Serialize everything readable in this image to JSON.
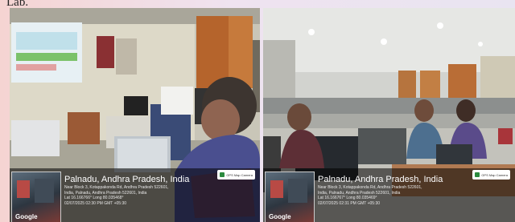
{
  "header_fragment": "Lab.",
  "photos": [
    {
      "alt": "Computer lab with projector screen and a man working on a laptop",
      "thumbnail_label": "Google",
      "badge_text": "GPS Map Camera",
      "location_title": "Palnadu, Andhra Pradesh, India",
      "address_line1": "Near Block 3, Kotappakonda Rd, Andhra Pradesh 522601,",
      "address_line2": "India, Palnadu, Andhra Pradesh 522601, India",
      "coords": "Lat 16.166766° Long 80.035468°",
      "datetime": "02/07/2025 02:30 PM GMT +05:30"
    },
    {
      "alt": "Large computer lab with three men at desks",
      "thumbnail_label": "Google",
      "badge_text": "GPS Map Camera",
      "location_title": "Palnadu, Andhra Pradesh, India",
      "address_line1": "Near Block 3, Kotappakonda Rd, Andhra Pradesh 522601,",
      "address_line2": "India, Palnadu, Andhra Pradesh 522601, India",
      "coords": "Lat 16.166767° Long 80.035469°",
      "datetime": "02/07/2025 02:31 PM GMT +05:30"
    }
  ]
}
